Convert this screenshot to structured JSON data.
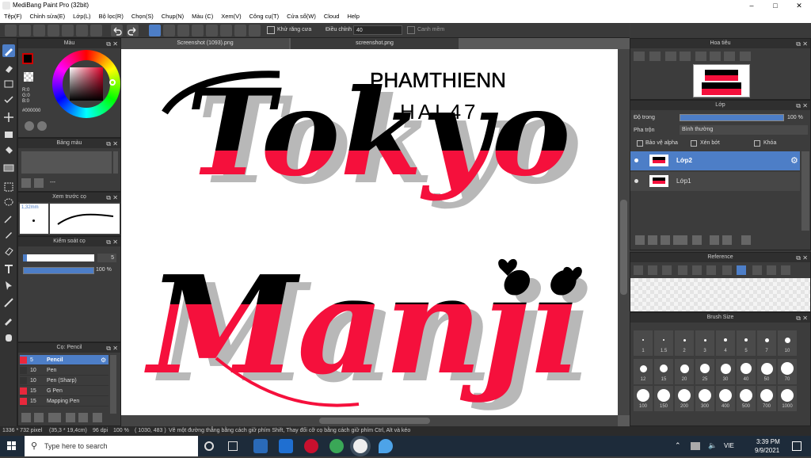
{
  "window": {
    "title": "MediBang Paint Pro (32bit)"
  },
  "menu": [
    "Tệp(F)",
    "Chỉnh sửa(E)",
    "Lớp(L)",
    "Bộ lọc(R)",
    "Chọn(S)",
    "Chụp(N)",
    "Màu (C)",
    "Xem(V)",
    "Công cụ(T)",
    "Cửa sổ(W)",
    "Cloud",
    "Help"
  ],
  "toolbar": {
    "antialias_label": "Khử răng cưa",
    "adjust_label": "Điều chỉnh",
    "adjust_value": "40",
    "snap_label": "Canh mềm"
  },
  "color_panel": {
    "title": "Màu",
    "r": "R:0",
    "g": "G:0",
    "b": "B:0",
    "hex": "#000000",
    "primary": "#cc0000"
  },
  "palette_panel": {
    "title": "Bảng màu",
    "name": "---"
  },
  "preview_panel": {
    "title": "Xem trước cọ",
    "size": "1,32mm"
  },
  "control_panel": {
    "title": "Kiểm soát cọ",
    "size_value": "5",
    "opacity_value": "100 %"
  },
  "brush_panel": {
    "title": "Cọ: Pencil",
    "items": [
      {
        "size": "5",
        "name": "Pencil"
      },
      {
        "size": "10",
        "name": "Pen"
      },
      {
        "size": "10",
        "name": "Pen (Sharp)"
      },
      {
        "size": "15",
        "name": "G Pen"
      },
      {
        "size": "15",
        "name": "Mapping Pen"
      }
    ]
  },
  "tabs": [
    "Screenshot (1093).png",
    "screenshot.png"
  ],
  "artwork": {
    "credit_line1": "PHAMTHIENN",
    "credit_line2": "HAL47",
    "word1": "Tokyo",
    "word2": "Manji"
  },
  "navigator_panel": {
    "title": "Hoa tiêu"
  },
  "layer_panel": {
    "title": "Lớp",
    "opacity_label": "Độ trong",
    "opacity_value": "100 %",
    "blend_label": "Pha trộn",
    "blend_value": "Bình thường",
    "alpha_label": "Bảo vệ alpha",
    "clip_label": "Xén bớt",
    "lock_label": "Khóa",
    "layers": [
      {
        "name": "Lớp2"
      },
      {
        "name": "Lớp1"
      }
    ]
  },
  "reference_panel": {
    "title": "Reference"
  },
  "brushsize_panel": {
    "title": "Brush Size",
    "sizes_row1": [
      "1",
      "1.5",
      "2",
      "3",
      "4",
      "5",
      "7",
      "10"
    ],
    "sizes_row2": [
      "12",
      "15",
      "20",
      "25",
      "30",
      "40",
      "50",
      "70"
    ],
    "sizes_row3": [
      "100",
      "150",
      "200",
      "300",
      "400",
      "500",
      "700",
      "1000"
    ]
  },
  "status": {
    "dimensions": "1336 * 732 pixel",
    "physical": "(35,3 * 19,4cm)",
    "dpi": "96 dpi",
    "zoom": "100 %",
    "coords": "( 1030, 483 )",
    "hint": "Vẽ một đường thẳng bằng cách giữ phím Shift, Thay đổi cỡ cọ bằng cách giữ phím Ctrl, Alt và kéo"
  },
  "taskbar": {
    "search_placeholder": "Type here to search",
    "lang": "VIE",
    "time": "3:39 PM",
    "date": "9/9/2021"
  },
  "colors": {
    "accent": "#4d7ec7",
    "artwork_red": "#f5103c",
    "artwork_black": "#000000"
  }
}
